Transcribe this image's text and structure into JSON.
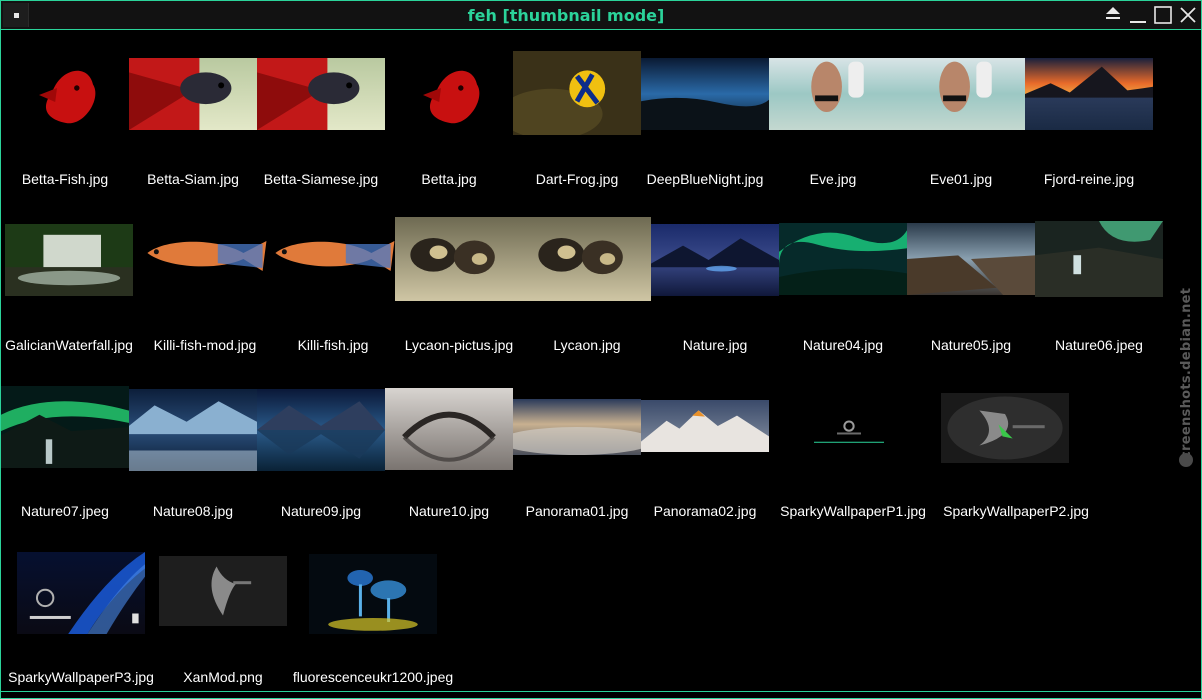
{
  "window": {
    "title": "feh [thumbnail mode]",
    "accent_color": "#2bd39a",
    "menu_icon": "window-menu-icon",
    "controls": {
      "shade_icon": "shade-icon",
      "minimize_icon": "minimize-icon",
      "maximize_icon": "maximize-icon",
      "close_icon": "close-icon"
    }
  },
  "thumbnails": [
    {
      "file": "Betta-Fish.jpg",
      "subject": "red betta fish"
    },
    {
      "file": "Betta-Siam.jpg",
      "subject": "betta fish on green"
    },
    {
      "file": "Betta-Siamese.jpg",
      "subject": "betta fish on green"
    },
    {
      "file": "Betta.jpg",
      "subject": "red betta fish"
    },
    {
      "file": "Dart-Frog.jpg",
      "subject": "dart frog"
    },
    {
      "file": "DeepBlueNight.jpg",
      "subject": "blue night coast"
    },
    {
      "file": "Eve.jpg",
      "subject": "beach"
    },
    {
      "file": "Eve01.jpg",
      "subject": "beach"
    },
    {
      "file": "Fjord-reine.jpg",
      "subject": "fjord sunset"
    },
    {
      "file": "GalicianWaterfall.jpg",
      "subject": "waterfall"
    },
    {
      "file": "Killi-fish-mod.jpg",
      "subject": "killifish"
    },
    {
      "file": "Killi-fish.jpg",
      "subject": "killifish"
    },
    {
      "file": "Lycaon-pictus.jpg",
      "subject": "wild dogs"
    },
    {
      "file": "Lycaon.jpg",
      "subject": "wild dogs"
    },
    {
      "file": "Nature.jpg",
      "subject": "blue lake"
    },
    {
      "file": "Nature04.jpg",
      "subject": "aurora"
    },
    {
      "file": "Nature05.jpg",
      "subject": "rocky coast"
    },
    {
      "file": "Nature06.jpeg",
      "subject": "aurora waterfall"
    },
    {
      "file": "Nature07.jpeg",
      "subject": "aurora mountain"
    },
    {
      "file": "Nature08.jpg",
      "subject": "snowy lake"
    },
    {
      "file": "Nature09.jpg",
      "subject": "mountain lake"
    },
    {
      "file": "Nature10.jpg",
      "subject": "stone bridge"
    },
    {
      "file": "Panorama01.jpg",
      "subject": "cloud panorama"
    },
    {
      "file": "Panorama02.jpg",
      "subject": "mountain panorama"
    },
    {
      "file": "SparkyWallpaperP1.jpg",
      "subject": "sparky wallpaper dark"
    },
    {
      "file": "SparkyWallpaperP2.jpg",
      "subject": "sparky wallpaper grey"
    },
    {
      "file": "SparkyWallpaperP3.jpg",
      "subject": "sparky wallpaper blue"
    },
    {
      "file": "XanMod.png",
      "subject": "xanmod logo"
    },
    {
      "file": "fluorescenceukr1200.jpeg",
      "subject": "glowing mushrooms"
    }
  ],
  "watermark": {
    "text": "screenshots.debian.net",
    "color": "#5a5a5a"
  }
}
